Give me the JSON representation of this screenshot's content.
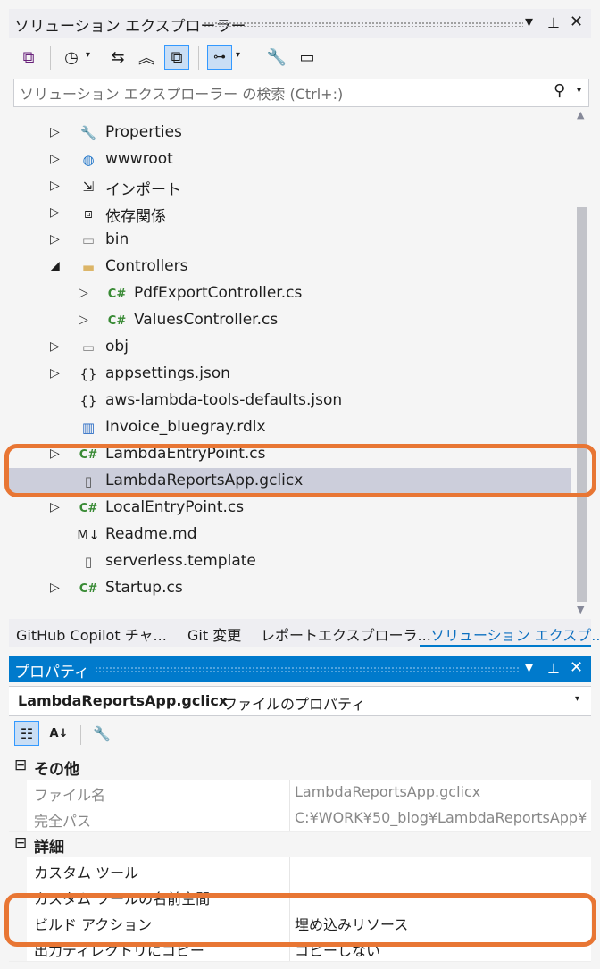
{
  "solution_explorer": {
    "title": "ソリューション エクスプローラー",
    "title_buttons": {
      "dropdown": "▼",
      "pin": "📌",
      "close": "✕"
    },
    "toolbar_icons": [
      "vs-switch-views-icon",
      "history-icon",
      "sync-icon",
      "collapse-all-icon",
      "show-all-files-icon",
      "filter-icon",
      "properties-icon",
      "preview-icon"
    ],
    "search_placeholder": "ソリューション エクスプローラー の検索 (Ctrl+:)",
    "tree": [
      {
        "label": "Properties",
        "icon": "wrench-folder-icon",
        "expander": "▷",
        "depth": 0
      },
      {
        "label": "wwwroot",
        "icon": "globe-icon",
        "expander": "▷",
        "depth": 0
      },
      {
        "label": "インポート",
        "icon": "import-icon",
        "expander": "▷",
        "depth": 0
      },
      {
        "label": "依存関係",
        "icon": "dependencies-icon",
        "expander": "▷",
        "depth": 0
      },
      {
        "label": "bin",
        "icon": "folder-dotted-icon",
        "expander": "▷",
        "depth": 0
      },
      {
        "label": "Controllers",
        "icon": "folder-open-icon",
        "expander": "◢",
        "depth": 0
      },
      {
        "label": "PdfExportController.cs",
        "icon": "csharp-icon",
        "expander": "▷",
        "depth": 1
      },
      {
        "label": "ValuesController.cs",
        "icon": "csharp-icon",
        "expander": "▷",
        "depth": 1
      },
      {
        "label": "obj",
        "icon": "folder-dotted-icon",
        "expander": "▷",
        "depth": 0
      },
      {
        "label": "appsettings.json",
        "icon": "json-icon",
        "expander": "▷",
        "depth": 0
      },
      {
        "label": "aws-lambda-tools-defaults.json",
        "icon": "json-icon",
        "expander": "",
        "depth": 0
      },
      {
        "label": "Invoice_bluegray.rdlx",
        "icon": "report-icon",
        "expander": "",
        "depth": 0
      },
      {
        "label": "LambdaEntryPoint.cs",
        "icon": "csharp-icon",
        "expander": "▷",
        "depth": 0
      },
      {
        "label": "LambdaReportsApp.gclicx",
        "icon": "file-icon",
        "expander": "",
        "depth": 0,
        "selected": true
      },
      {
        "label": "LocalEntryPoint.cs",
        "icon": "csharp-icon",
        "expander": "▷",
        "depth": 0
      },
      {
        "label": "Readme.md",
        "icon": "markdown-icon",
        "expander": "",
        "depth": 0
      },
      {
        "label": "serverless.template",
        "icon": "file-icon",
        "expander": "",
        "depth": 0
      },
      {
        "label": "Startup.cs",
        "icon": "csharp-icon",
        "expander": "▷",
        "depth": 0
      }
    ],
    "tabs": [
      "GitHub Copilot チャ...",
      "Git 変更",
      "レポートエクスプローラ...",
      "ソリューション エクスプ..."
    ],
    "active_tab": 3
  },
  "properties": {
    "title": "プロパティ",
    "object_name": "LambdaReportsApp.gclicx",
    "object_type": "ファイルのプロパティ",
    "categories": [
      {
        "name": "その他",
        "toggle": "⊟",
        "rows": [
          {
            "name": "ファイル名",
            "value": "LambdaReportsApp.gclicx",
            "readonly": true
          },
          {
            "name": "完全パス",
            "value": "C:¥WORK¥50_blog¥LambdaReportsApp¥",
            "readonly": true
          }
        ]
      },
      {
        "name": "詳細",
        "toggle": "⊟",
        "rows": [
          {
            "name": "カスタム ツール",
            "value": "",
            "readonly": false
          },
          {
            "name": "カスタム ツールの名前空間",
            "value": "",
            "readonly": false
          },
          {
            "name": "ビルド アクション",
            "value": "埋め込みリソース",
            "readonly": false
          },
          {
            "name": "出力ディレクトリにコピー",
            "value": "コピーしない",
            "readonly": false
          }
        ]
      }
    ]
  },
  "colors": {
    "accent": "#007acc",
    "highlight": "#e87634",
    "selection": "#cccedb",
    "csharp": "#388a34"
  }
}
